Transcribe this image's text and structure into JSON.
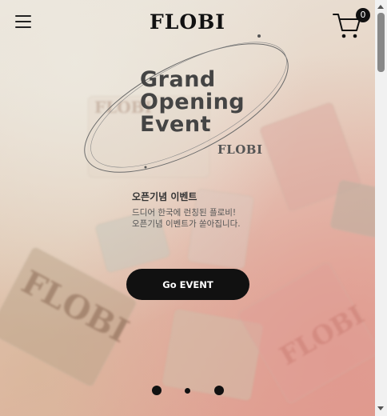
{
  "header": {
    "menu_icon": "hamburger-menu-icon",
    "logo": "FLOBI",
    "cart_icon": "shopping-cart-icon",
    "cart_count": "0"
  },
  "hero": {
    "title_lines": [
      "Grand",
      "Opening",
      "Event"
    ],
    "brand": "FLOBI",
    "event_name": "오픈기념 이벤트",
    "event_desc_lines": [
      "드디어 한국에 런칭된 플로비!",
      "오픈기념 이벤트가 쏟아집니다."
    ],
    "cta_label": "Go EVENT"
  },
  "background_text": {
    "watermark_1": "FLOBI",
    "watermark_2": "FLOBI",
    "watermark_3": "FLOBI"
  },
  "carousel": {
    "slide_count": 3,
    "active_index": 1
  },
  "colors": {
    "accent": "#111111",
    "background_start": "#ebe6dd",
    "background_end": "#dfa092"
  }
}
